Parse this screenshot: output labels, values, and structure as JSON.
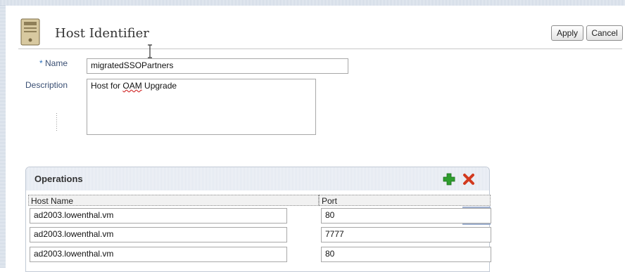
{
  "header": {
    "title": "Host Identifier",
    "icon": "server-icon"
  },
  "toolbar": {
    "apply_label": "Apply",
    "cancel_label": "Cancel"
  },
  "form": {
    "name_required_marker": "*",
    "name_label": "Name",
    "name_value": "migratedSSOPartners",
    "description_label": "Description",
    "description_value_prefix": "Host for ",
    "description_value_underlined": "OAM",
    "description_value_suffix": " Upgrade"
  },
  "operations": {
    "title": "Operations",
    "add_icon": "add-icon",
    "delete_icon": "delete-icon",
    "columns": [
      "Host Name",
      "Port"
    ],
    "rows": [
      {
        "host": "ad2003.lowenthal.vm",
        "port": "80"
      },
      {
        "host": "ad2003.lowenthal.vm",
        "port": "7777"
      },
      {
        "host": "ad2003.lowenthal.vm",
        "port": "80"
      }
    ]
  },
  "colors": {
    "label": "#3a4f73",
    "add_green": "#2e9d2e",
    "delete_red": "#d23a1f",
    "selection": "#9fb0cf"
  }
}
